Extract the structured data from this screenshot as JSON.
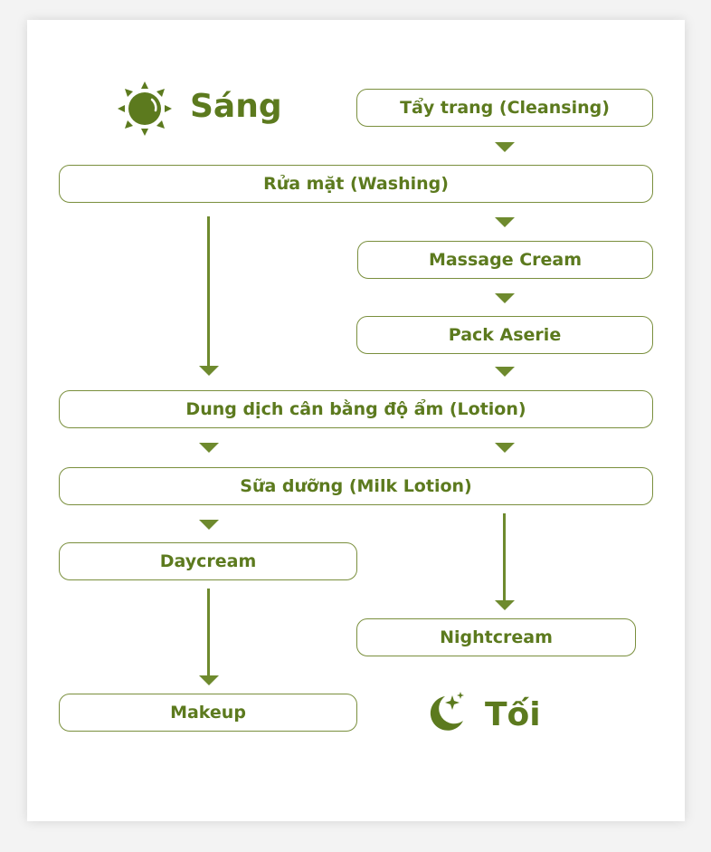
{
  "morning": {
    "label": "Sáng",
    "icon": "sun-icon"
  },
  "evening": {
    "label": "Tối",
    "icon": "moon-stars-icon"
  },
  "steps": {
    "cleansing": "Tẩy trang (Cleansing)",
    "washing": "Rửa mặt (Washing)",
    "massage": "Massage Cream",
    "pack": "Pack Aserie",
    "lotion": "Dung dịch cân bằng độ ẩm (Lotion)",
    "milk": "Sữa dưỡng (Milk Lotion)",
    "daycream": "Daycream",
    "nightcream": "Nightcream",
    "makeup": "Makeup"
  },
  "colors": {
    "accent": "#5c7a1e",
    "arrow": "#6e8a2e",
    "border": "#7a8f3d"
  }
}
